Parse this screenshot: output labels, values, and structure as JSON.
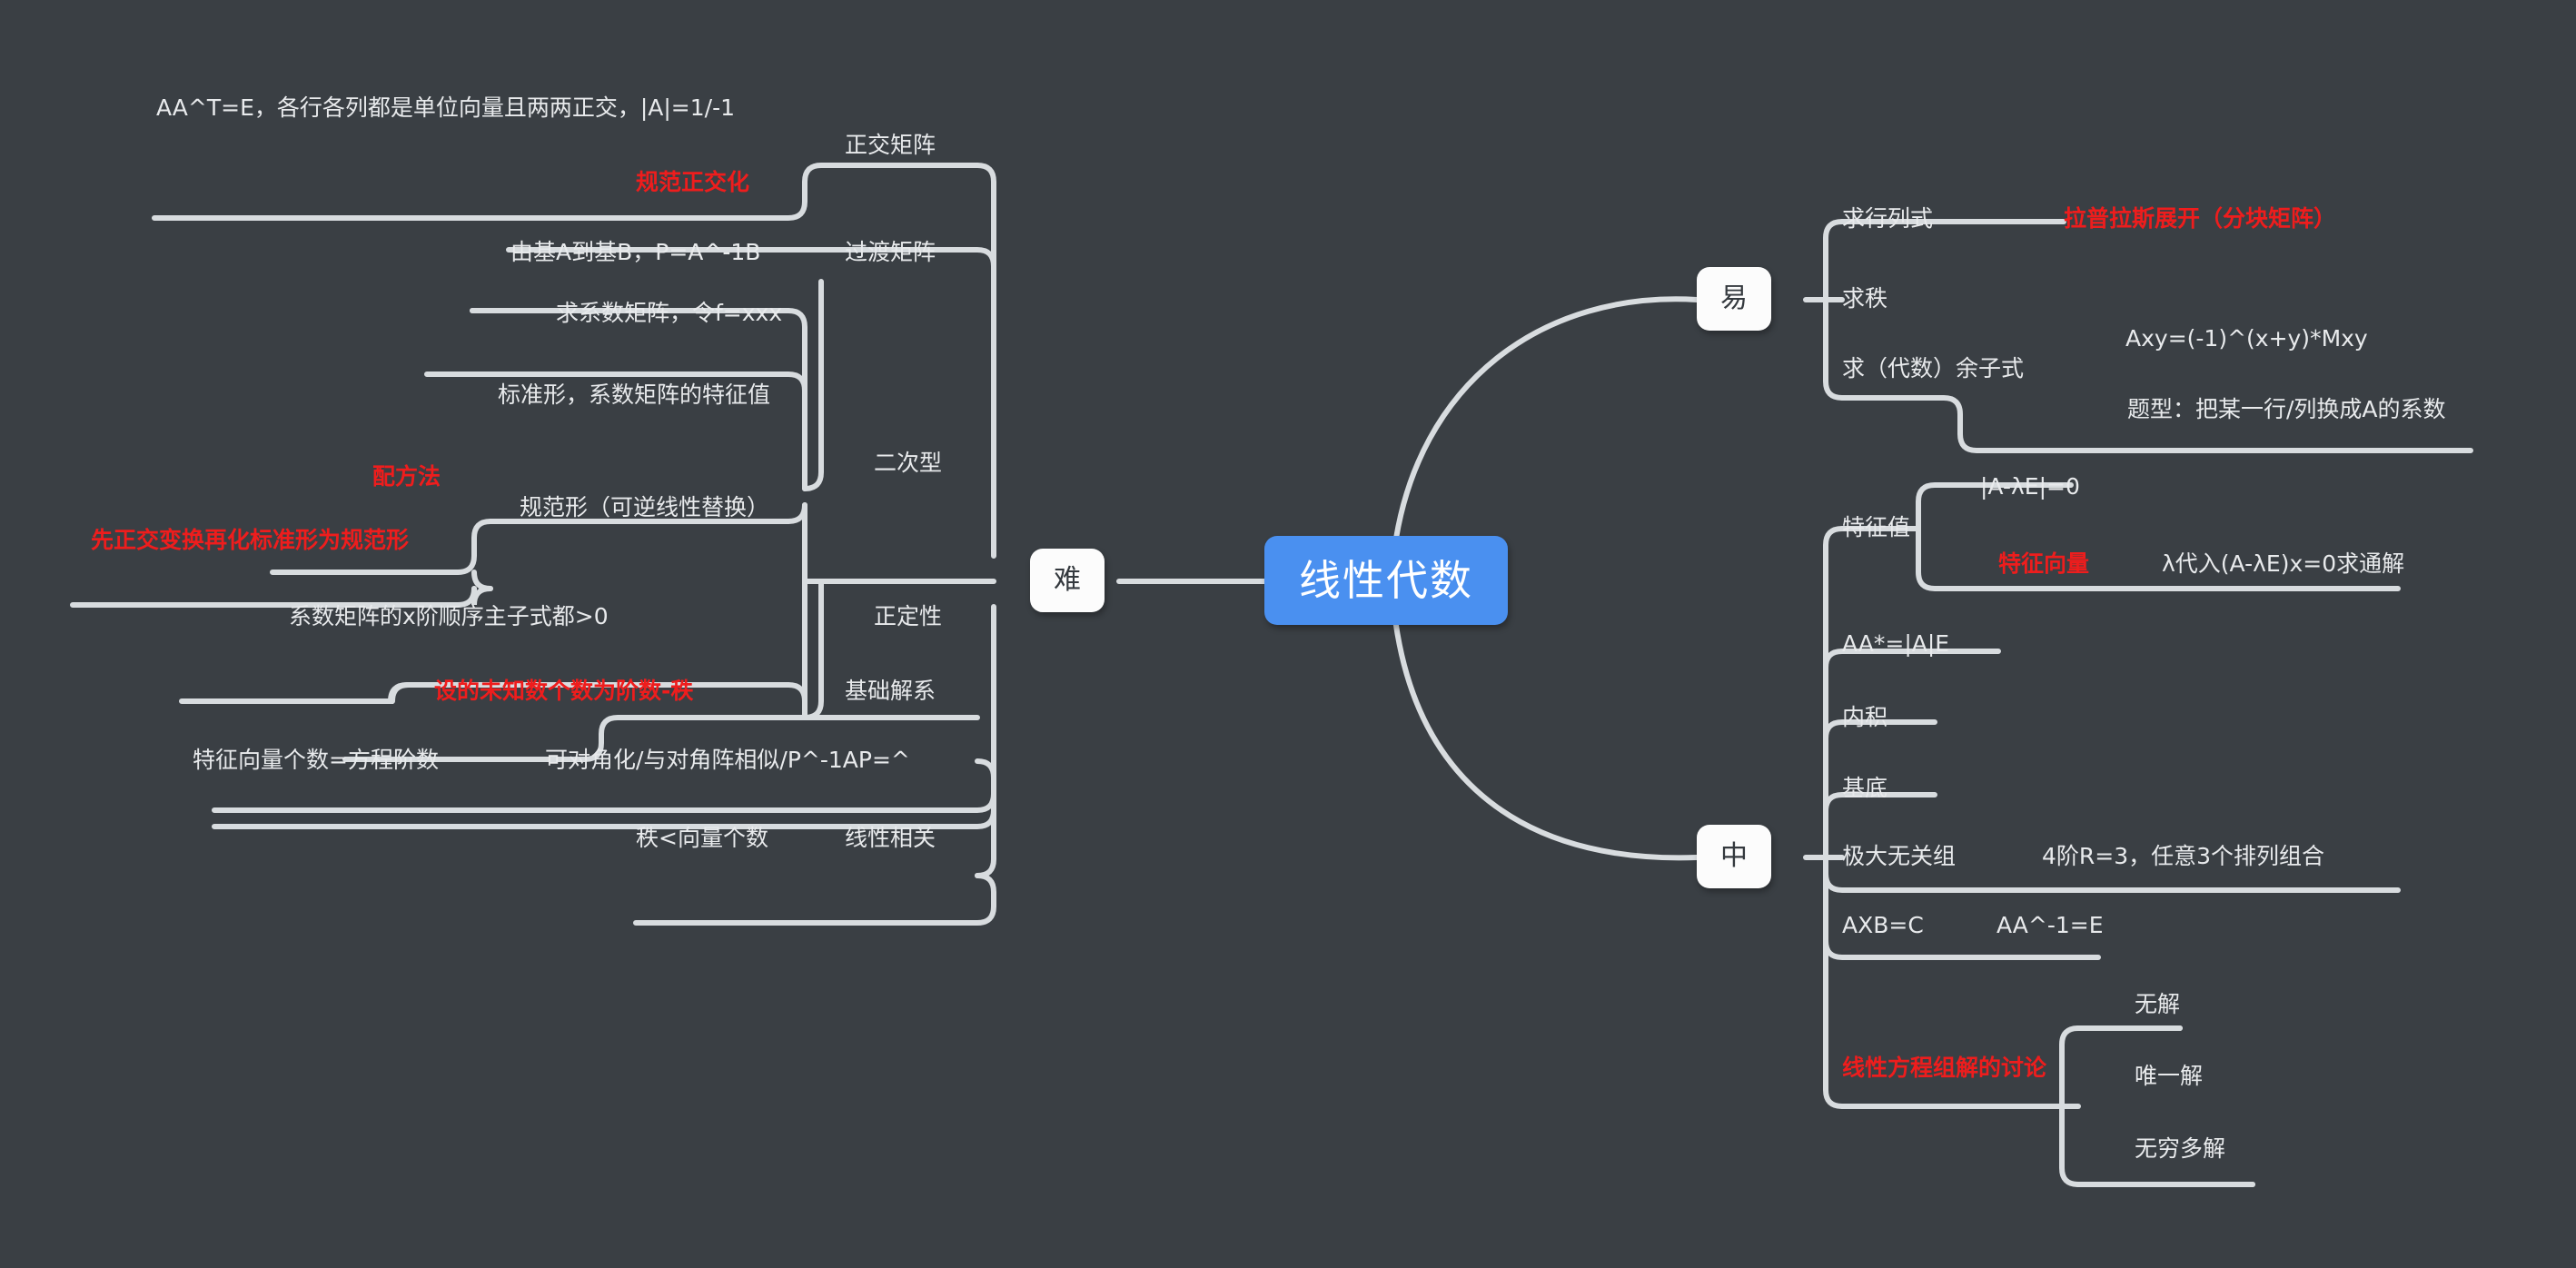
{
  "meta": {
    "background": "#3a3f44",
    "root_color": "#4a90f0",
    "chip_color": "#fcfcfc",
    "text_color": "#e8eaec",
    "accent_color": "#ee1d1d",
    "wire_color": "#d8dcdf"
  },
  "root": {
    "label": "线性代数"
  },
  "branches": {
    "hard": {
      "label": "难"
    },
    "easy": {
      "label": "易"
    },
    "medium": {
      "label": "中"
    }
  },
  "hard_topics": [
    {
      "label": "正交矩阵",
      "note": "AA^T=E，各行各列都是单位向量且两两正交，|A|=1/-1",
      "accent": "规范正交化"
    },
    {
      "label": "过渡矩阵",
      "note": "由基A到基B，P=A^-1B"
    },
    {
      "label": "二次型"
    },
    {
      "label": "基础解系",
      "accent": "设的未知数个数为阶数-秩"
    },
    {
      "label": "可对角化/与对角阵相似/P^-1AP=^",
      "note": "特征向量个数=方程阶数"
    },
    {
      "label": "线性相关",
      "note": "秩<向量个数"
    }
  ],
  "quadratic_children": [
    {
      "label": "求系数矩阵，令f=xxx"
    },
    {
      "label": "标准形，系数矩阵的特征值"
    },
    {
      "label": "规范形（可逆线性替换）",
      "accent1": "配方法",
      "accent2": "先正交变换再化标准形为规范形"
    },
    {
      "label": "正定性",
      "note": "系数矩阵的x阶顺序主子式都>0"
    }
  ],
  "easy_topics": [
    {
      "label": "求行列式",
      "accent": "拉普拉斯展开（分块矩阵）"
    },
    {
      "label": "求秩"
    },
    {
      "label": "求（代数）余子式",
      "note": "Axy=(-1)^(x+y)*Mxy",
      "detail": "题型：把某一行/列换成A的系数"
    }
  ],
  "medium_topics": [
    {
      "label": "特征值",
      "note": "|A-λE|=0",
      "accent": "特征向量",
      "accent_note": "λ代入(A-λE)x=0求通解"
    },
    {
      "label": "AA*=|A|E"
    },
    {
      "label": "内积"
    },
    {
      "label": "基底"
    },
    {
      "label": "极大无关组",
      "note": "4阶R=3，任意3个排列组合"
    },
    {
      "label": "AXB=C",
      "note": "AA^-1=E"
    },
    {
      "label": "线性方程组解的讨论",
      "accent": true,
      "children": [
        "无解",
        "唯一解",
        "无穷多解"
      ]
    }
  ]
}
